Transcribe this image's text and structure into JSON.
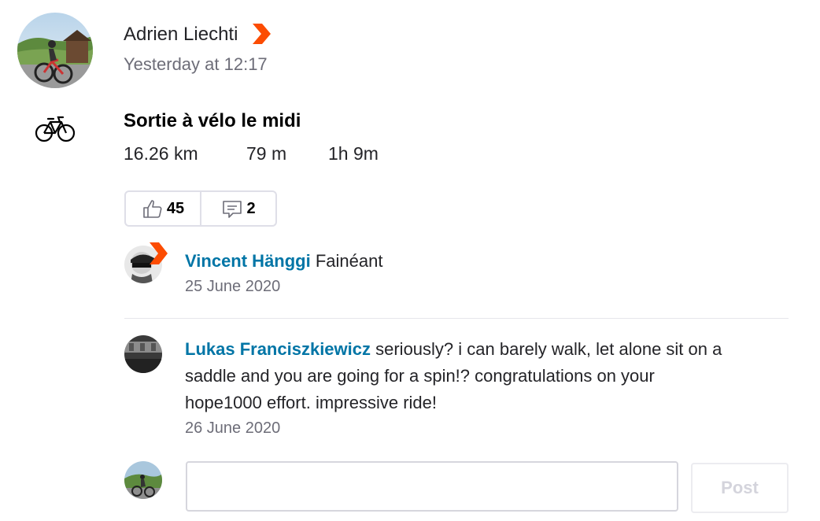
{
  "post": {
    "athlete_name": "Adrien Liechti",
    "timestamp": "Yesterday at 12:17",
    "sport_icon": "bicycle-icon",
    "activity_title": "Sortie à vélo le midi",
    "stats": {
      "distance": "16.26 km",
      "elevation": "79 m",
      "time": "1h 9m"
    },
    "kudos_count": "45",
    "comment_count": "2",
    "badge_color": "#fc4c02"
  },
  "comments": [
    {
      "author": "Vincent Hänggi",
      "text": "Fainéant",
      "date": "25 June 2020"
    },
    {
      "author": "Lukas Franciszkiewicz",
      "text_line1": "seriously? i can barely walk, let alone sit on a",
      "text_line2": "saddle and you are going for a spin!? congratulations on your",
      "text_line3": "hope1000 effort. impressive ride!",
      "date": "26 June 2020"
    }
  ],
  "composer": {
    "placeholder": "",
    "post_label": "Post"
  }
}
